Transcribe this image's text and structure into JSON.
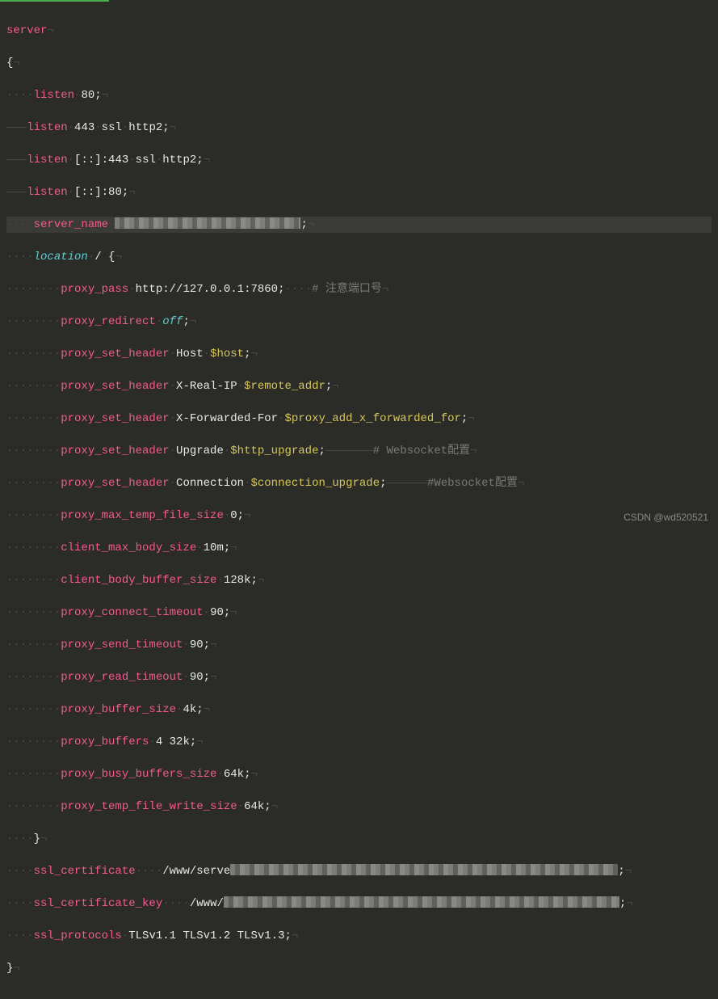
{
  "whitespace": {
    "dot4": "····",
    "dot8": "········",
    "tab": "———",
    "nl": "¬"
  },
  "code": {
    "server": "server",
    "brace_open": "{",
    "brace_close": "}",
    "listen80": {
      "dir": "listen",
      "val": "80;"
    },
    "listen443": {
      "dir": "listen",
      "val": "443",
      "p1": "ssl",
      "p2": "http2;"
    },
    "listen443v6": {
      "dir": "listen",
      "val": "[::]:443",
      "p1": "ssl",
      "p2": "http2;"
    },
    "listen80v6": {
      "dir": "listen",
      "val": "[::]:80;"
    },
    "server_name": {
      "dir": "server_name"
    },
    "location": {
      "dir": "location",
      "path": "/ {"
    },
    "proxy_pass": {
      "dir": "proxy_pass",
      "val": "http://127.0.0.1:7860;",
      "comment": "# 注意端口号"
    },
    "proxy_redirect": {
      "dir": "proxy_redirect",
      "val": "off",
      "semi": ";"
    },
    "psh_host": {
      "dir": "proxy_set_header",
      "n": "Host",
      "v": "$host",
      "semi": ";"
    },
    "psh_realip": {
      "dir": "proxy_set_header",
      "n": "X-Real-IP",
      "v": "$remote_addr",
      "semi": ";"
    },
    "psh_xff": {
      "dir": "proxy_set_header",
      "n": "X-Forwarded-For",
      "v": "$proxy_add_x_forwarded_for",
      "semi": ";"
    },
    "psh_upgrade": {
      "dir": "proxy_set_header",
      "n": "Upgrade",
      "v": "$http_upgrade",
      "semi": ";",
      "comment": "# Websocket配置"
    },
    "psh_conn": {
      "dir": "proxy_set_header",
      "n": "Connection",
      "v": "$connection_upgrade",
      "semi": ";",
      "comment": "#Websocket配置"
    },
    "pmtfs": {
      "dir": "proxy_max_temp_file_size",
      "val": "0;"
    },
    "cmbs": {
      "dir": "client_max_body_size",
      "val": "10m;"
    },
    "cbbs": {
      "dir": "client_body_buffer_size",
      "val": "128k;"
    },
    "pct": {
      "dir": "proxy_connect_timeout",
      "val": "90;"
    },
    "pst": {
      "dir": "proxy_send_timeout",
      "val": "90;"
    },
    "prt": {
      "dir": "proxy_read_timeout",
      "val": "90;"
    },
    "pbs": {
      "dir": "proxy_buffer_size",
      "val": "4k;"
    },
    "pb": {
      "dir": "proxy_buffers",
      "val": "4 32k;"
    },
    "pbbs": {
      "dir": "proxy_busy_buffers_size",
      "val": "64k;"
    },
    "ptfws": {
      "dir": "proxy_temp_file_write_size",
      "val": "64k;"
    },
    "ssl_cert": {
      "dir": "ssl_certificate",
      "val": "/www/serve"
    },
    "ssl_key": {
      "dir": "ssl_certificate_key",
      "val": "/www/"
    },
    "ssl_proto": {
      "dir": "ssl_protocols",
      "val": "TLSv1.1 TLSv1.2 TLSv1.3;"
    }
  },
  "watermark": "CSDN @wd520521"
}
